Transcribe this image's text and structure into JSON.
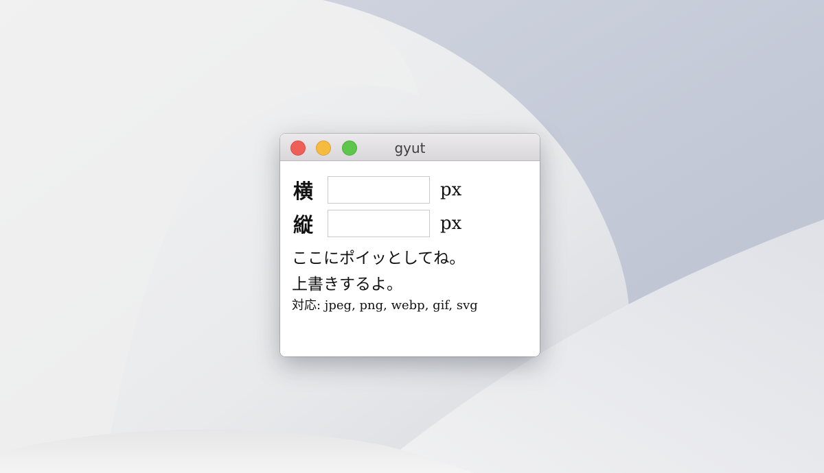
{
  "window": {
    "title": "gyut",
    "controls": [
      "close-button",
      "minimize-button",
      "zoom-button"
    ]
  },
  "form": {
    "width_label": "横",
    "width_value": "",
    "width_unit": "px",
    "height_label": "縦",
    "height_value": "",
    "height_unit": "px"
  },
  "messages": {
    "drop_hint": "ここにポイッとしてね。",
    "overwrite_note": "上書きするよ。",
    "formats": "対応: jpeg, png, webp, gif, svg"
  },
  "colors": {
    "close": "#f05f57",
    "minimize": "#f5bb3f",
    "zoom": "#5ec64b"
  }
}
